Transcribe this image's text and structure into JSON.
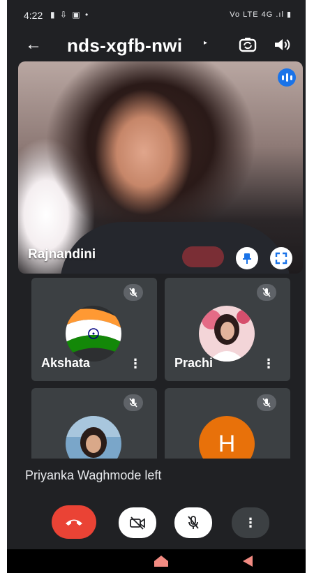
{
  "status_bar": {
    "time": "4:22",
    "notification_icons": "▮ ⇩ ▣ •",
    "system_text": "Vo LTE 4G .ıl ▮"
  },
  "app_bar": {
    "meeting_code": "nds-xgfb-nwi",
    "caret": "▸"
  },
  "main_tile": {
    "participant_name": "Rajnandini"
  },
  "participants": [
    {
      "name": "Akshata",
      "avatar": "indian-flag"
    },
    {
      "name": "Prachi",
      "avatar": "photo"
    },
    {
      "name": "",
      "avatar": "photo"
    },
    {
      "name": "",
      "avatar_letter": "H",
      "avatar_color": "#e8710a"
    }
  ],
  "toast": {
    "message": "Priyanka Waghmode left"
  },
  "controls": {
    "end_call_color": "#ea4335"
  }
}
